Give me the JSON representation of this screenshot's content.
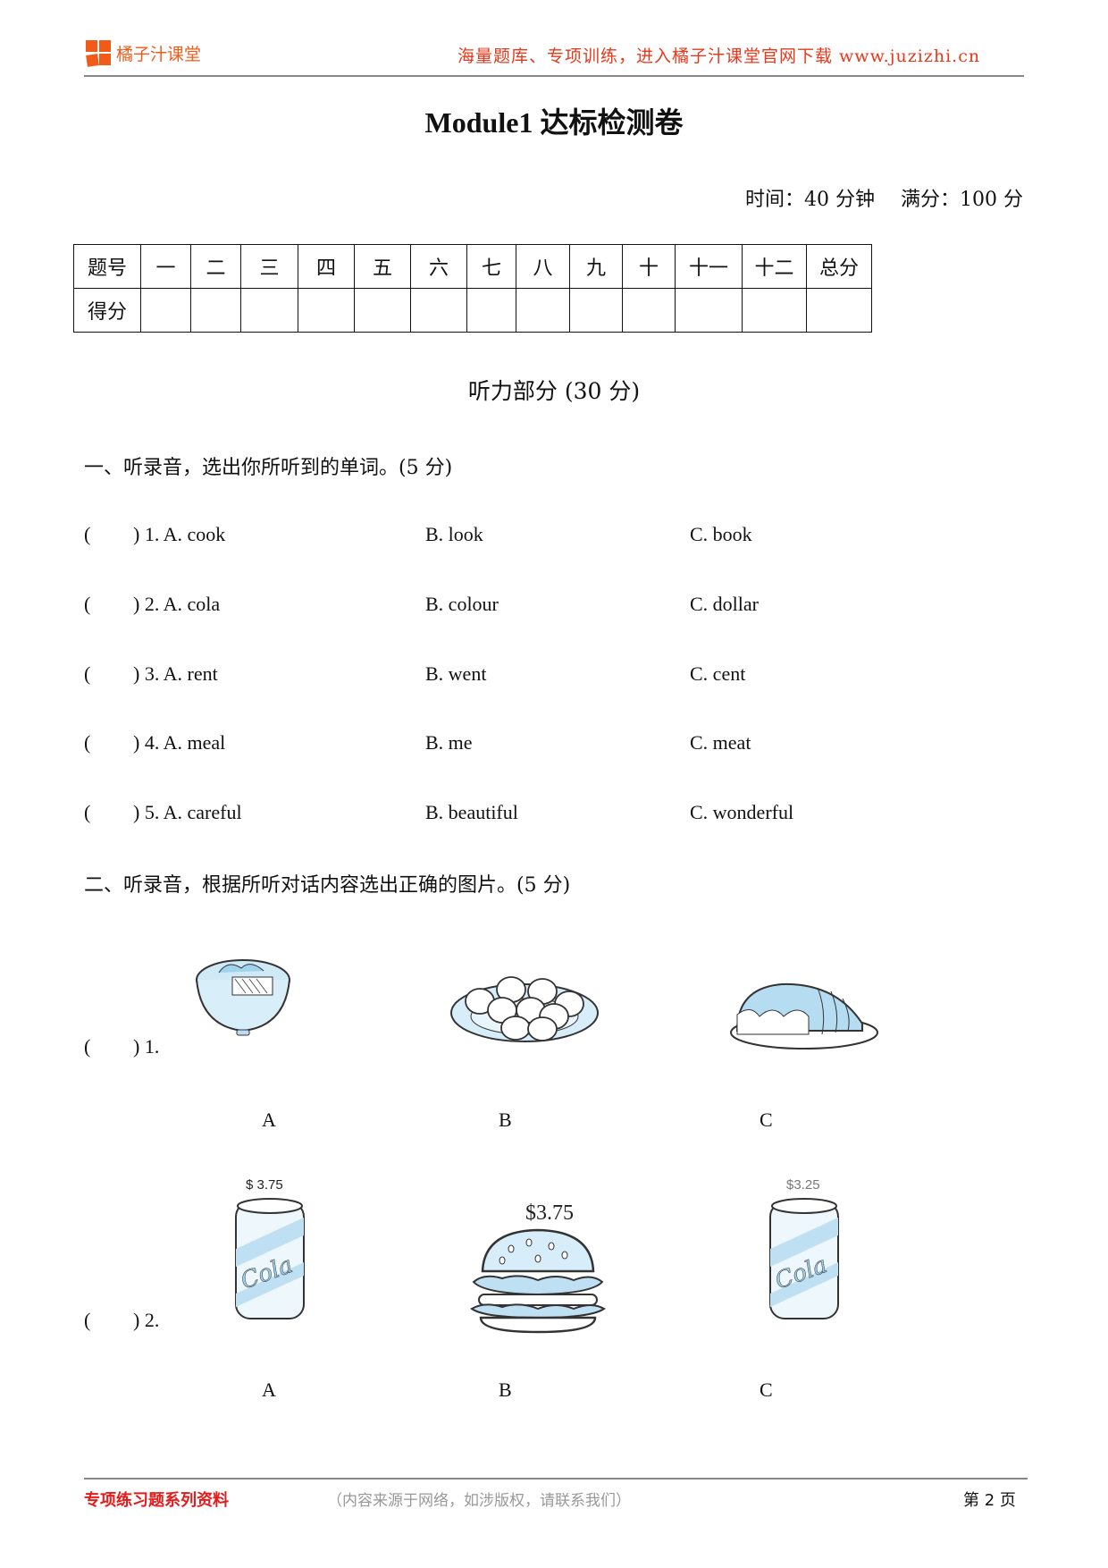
{
  "header": {
    "brand": "橘子汁课堂",
    "slogan": "海量题库、专项训练，进入橘子汁课堂官网下载 www.juzizhi.cn",
    "brand_color": "#f25a1a",
    "slogan_color": "#e8381b"
  },
  "doc": {
    "title": "Module1 达标检测卷",
    "time_info": "时间：40 分钟　 满分：100 分"
  },
  "score_table": {
    "row1_header": "题号",
    "row2_header": "得分",
    "columns": [
      "一",
      "二",
      "三",
      "四",
      "五",
      "六",
      "七",
      "八",
      "九",
      "十",
      "十一",
      "十二",
      "总分"
    ]
  },
  "listening": {
    "title": "听力部分 (30 分)"
  },
  "section1": {
    "heading": "一、听录音，选出你所听到的单词。(5 分)",
    "questions": [
      {
        "num": ") 1. A. cook",
        "b": "B. look",
        "c": "C. book"
      },
      {
        "num": ") 2. A. cola",
        "b": "B. colour",
        "c": "C. dollar"
      },
      {
        "num": ") 3. A. rent",
        "b": "B. went",
        "c": "C. cent"
      },
      {
        "num": ") 4. A. meal",
        "b": "B. me",
        "c": "C. meat"
      },
      {
        "num": ") 5. A. careful",
        "b": "B. beautiful",
        "c": "C. wonderful"
      }
    ],
    "open_paren": "("
  },
  "section2": {
    "heading": "二、听录音，根据所听对话内容选出正确的图片。(5 分)",
    "questions": [
      {
        "num": ") 1.",
        "options": [
          {
            "label": "A",
            "icon": "noodle-bowl-icon"
          },
          {
            "label": "B",
            "icon": "dumplings-plate-icon"
          },
          {
            "label": "C",
            "icon": "bread-loaf-icon"
          }
        ]
      },
      {
        "num": ") 2.",
        "options": [
          {
            "label": "A",
            "icon": "cola-can-icon",
            "price": "$ 3.75"
          },
          {
            "label": "B",
            "icon": "hamburger-icon",
            "price": "$3.75"
          },
          {
            "label": "C",
            "icon": "cola-can-icon",
            "price": "$3.25"
          }
        ]
      }
    ]
  },
  "footer": {
    "left": "专项练习题系列资料",
    "middle": "（内容来源于网络，如涉版权，请联系我们）",
    "page": "第 2 页"
  }
}
